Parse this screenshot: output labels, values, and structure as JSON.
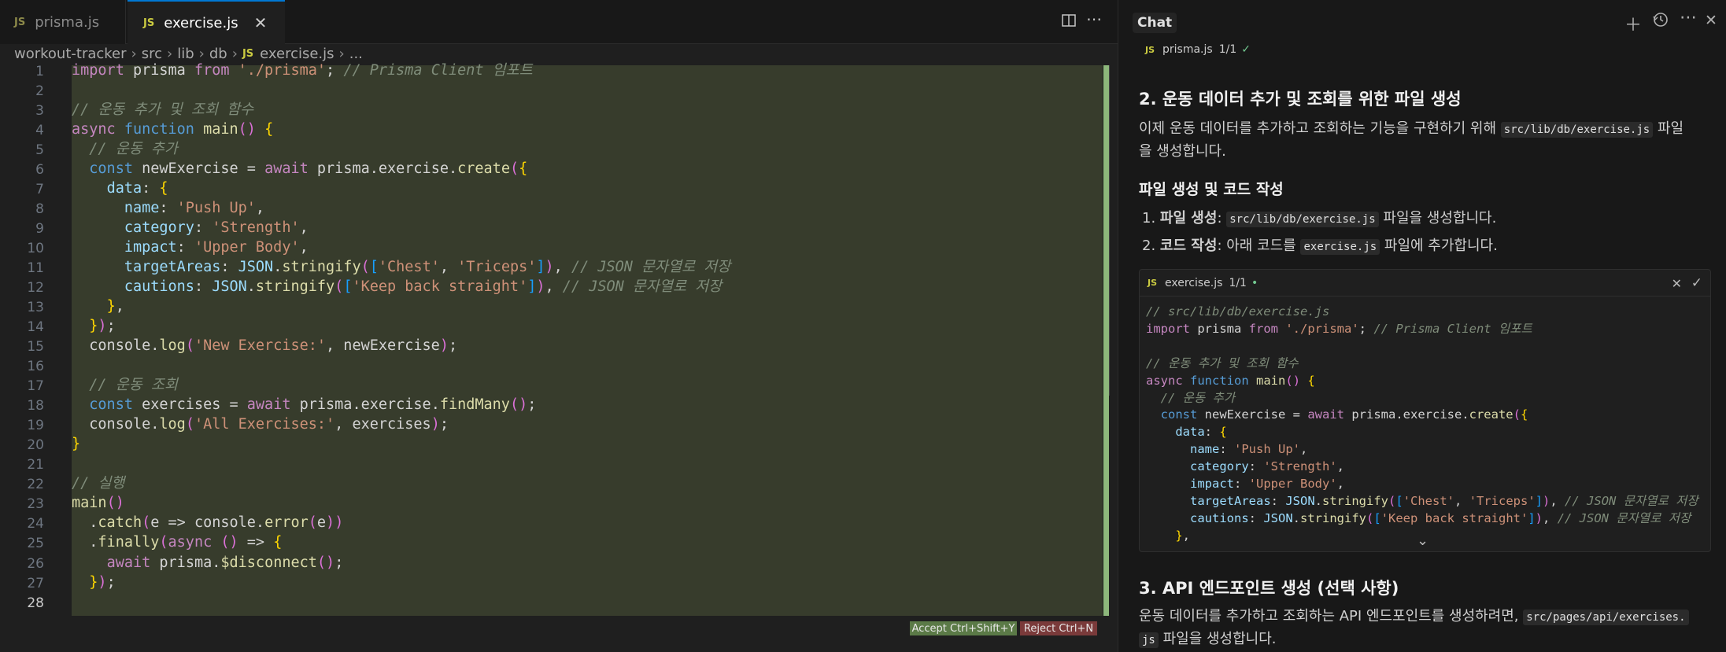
{
  "editor": {
    "tabs": [
      {
        "icon": "JS",
        "label": "prisma.js",
        "active": false
      },
      {
        "icon": "JS",
        "label": "exercise.js",
        "active": true
      }
    ],
    "breadcrumb": [
      "workout-tracker",
      "src",
      "lib",
      "db",
      "exercise.js",
      "..."
    ],
    "line_numbers": [
      "1",
      "2",
      "3",
      "4",
      "5",
      "6",
      "7",
      "8",
      "9",
      "10",
      "11",
      "12",
      "13",
      "14",
      "15",
      "16",
      "17",
      "18",
      "19",
      "20",
      "21",
      "22",
      "23",
      "24",
      "25",
      "26",
      "27",
      "28"
    ],
    "lines": [
      "import prisma from './prisma'; // Prisma Client 임포트",
      "",
      "// 운동 추가 및 조회 함수",
      "async function main() {",
      "  // 운동 추가",
      "  const newExercise = await prisma.exercise.create({",
      "    data: {",
      "      name: 'Push Up',",
      "      category: 'Strength',",
      "      impact: 'Upper Body',",
      "      targetAreas: JSON.stringify(['Chest', 'Triceps']), // JSON 문자열로 저장",
      "      cautions: JSON.stringify(['Keep back straight']), // JSON 문자열로 저장",
      "    },",
      "  });",
      "  console.log('New Exercise:', newExercise);",
      "",
      "  // 운동 조회",
      "  const exercises = await prisma.exercise.findMany();",
      "  console.log('All Exercises:', exercises);",
      "}",
      "",
      "// 실행",
      "main()",
      "  .catch(e => console.error(e))",
      "  .finally(async () => {",
      "    await prisma.$disconnect();",
      "  });",
      ""
    ],
    "accept_label": "Accept Ctrl+Shift+Y",
    "reject_label": "Reject Ctrl+N"
  },
  "chat": {
    "title": "Chat",
    "attached_file": {
      "icon": "JS",
      "name": "prisma.js",
      "count": "1/1"
    },
    "section2_heading": "2. 운동 데이터 추가 및 조회를 위한 파일 생성",
    "section2_para_a": "이제 운동 데이터를 추가하고 조회하는 기능을 구현하기 위해 ",
    "section2_para_code": "src/lib/db/exercise.js",
    "section2_para_b": " 파일",
    "section2_para_c": "을 생성합니다.",
    "subheading": "파일 생성 및 코드 작성",
    "steps": [
      {
        "num": "1.",
        "bold": "파일 생성",
        "colon": ": ",
        "code": "src/lib/db/exercise.js",
        "rest": " 파일을 생성합니다."
      },
      {
        "num": "2.",
        "bold": "코드 작성",
        "colon": ": 아래 코드를 ",
        "code": "exercise.js",
        "rest": " 파일에 추가합니다."
      }
    ],
    "code_card": {
      "file_icon": "JS",
      "file_name": "exercise.js",
      "count": "1/1",
      "lines": [
        "// src/lib/db/exercise.js",
        "import prisma from './prisma'; // Prisma Client 임포트",
        "",
        "// 운동 추가 및 조회 함수",
        "async function main() {",
        "  // 운동 추가",
        "  const newExercise = await prisma.exercise.create({",
        "    data: {",
        "      name: 'Push Up',",
        "      category: 'Strength',",
        "      impact: 'Upper Body',",
        "      targetAreas: JSON.stringify(['Chest', 'Triceps']), // JSON 문자열로 저장",
        "      cautions: JSON.stringify(['Keep back straight']), // JSON 문자열로 저장",
        "    },"
      ]
    },
    "section3_heading": "3. API 엔드포인트 생성 (선택 사항)",
    "section3_para_a": "운동 데이터를 추가하고 조회하는 API 엔드포인트를 생성하려면, ",
    "section3_para_code_a": "src/pages/api/exercises.",
    "section3_para_code_b": "js",
    "section3_para_b": " 파일을 생성합니다."
  },
  "colors": {
    "accent": "#0078d4",
    "accept": "#5b7a47",
    "reject": "#7a3a3a",
    "diff_added_bg": "#373c2c",
    "change_bar": "#8db77b"
  }
}
